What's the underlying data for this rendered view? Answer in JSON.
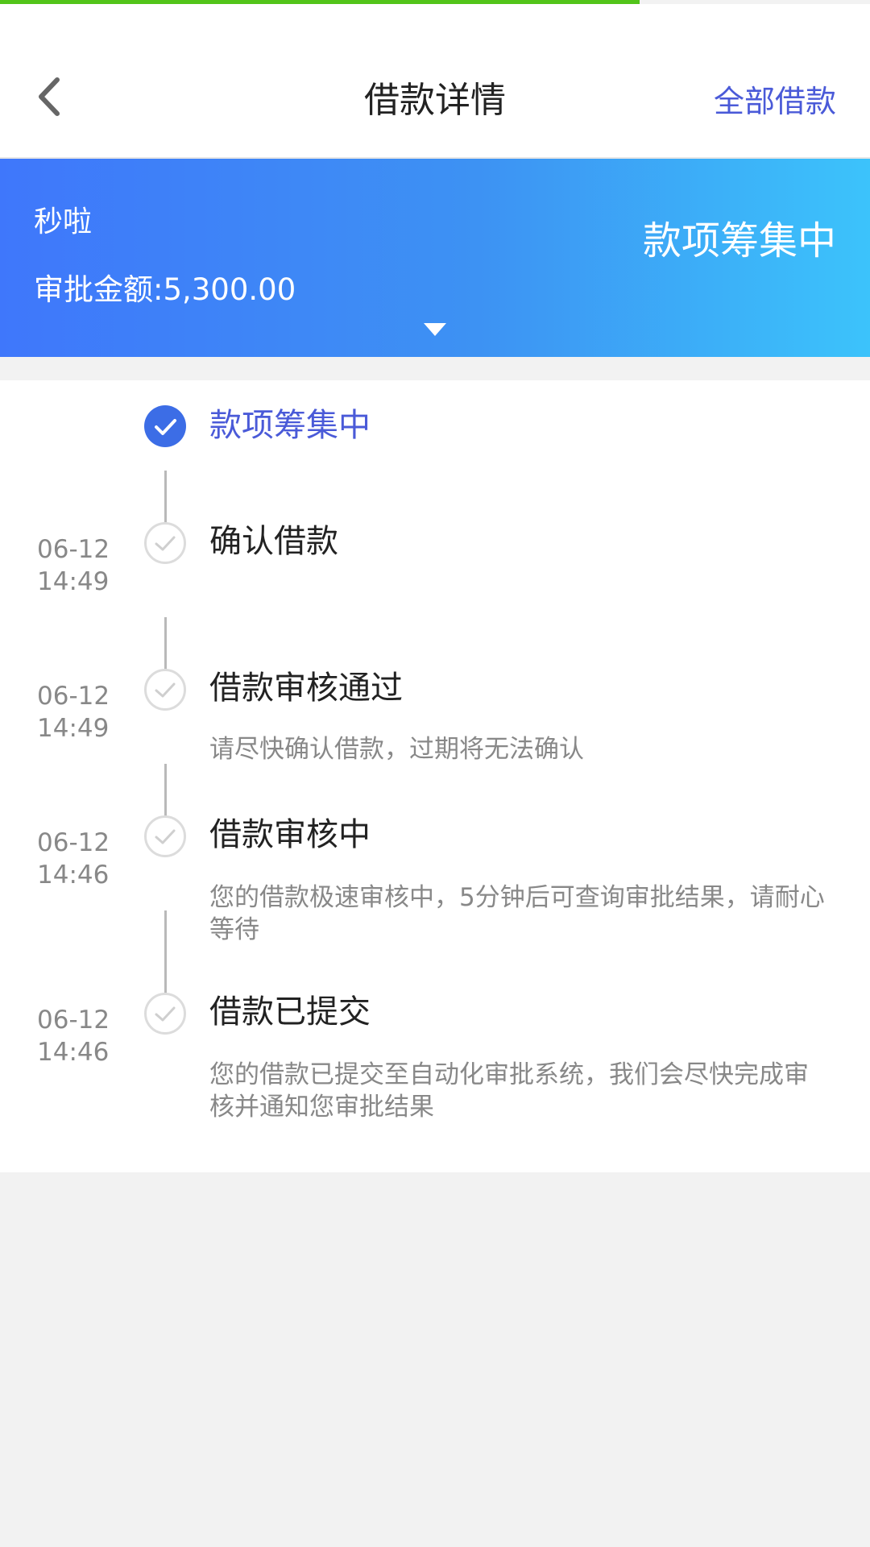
{
  "progress": {
    "fraction": 0.735,
    "color": "#52c41a"
  },
  "header": {
    "title": "借款详情",
    "right_action": "全部借款",
    "back_icon": "chevron-left-icon"
  },
  "banner": {
    "lender": "秒啦",
    "approval_label": "审批金额:",
    "approval_amount": "5,300.00",
    "status": "款项筹集中",
    "gradient_colors": [
      "#3f77fb",
      "#3cc3fb"
    ]
  },
  "timeline": {
    "accent_color": "#4a5ad8",
    "steps": [
      {
        "date": "",
        "time": "",
        "title": "款项筹集中",
        "description": "",
        "state": "current"
      },
      {
        "date": "06-12",
        "time": "14:49",
        "title": "确认借款",
        "description": "",
        "state": "done"
      },
      {
        "date": "06-12",
        "time": "14:49",
        "title": "借款审核通过",
        "description": "请尽快确认借款，过期将无法确认",
        "state": "done"
      },
      {
        "date": "06-12",
        "time": "14:46",
        "title": "借款审核中",
        "description": "您的借款极速审核中，5分钟后可查询审批结果，请耐心等待",
        "state": "done"
      },
      {
        "date": "06-12",
        "time": "14:46",
        "title": "借款已提交",
        "description": "您的借款已提交至自动化审批系统，我们会尽快完成审核并通知您审批结果",
        "state": "done"
      }
    ]
  }
}
